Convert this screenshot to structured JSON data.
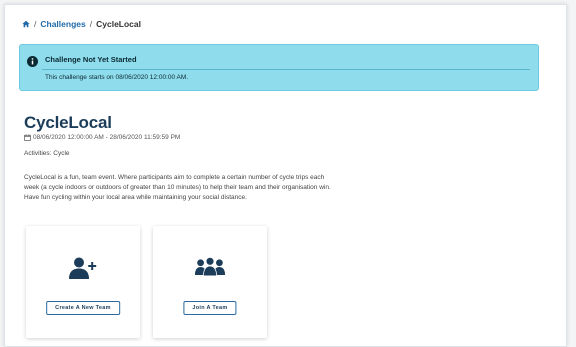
{
  "breadcrumb": {
    "home_icon": "home-icon",
    "sep1": "/",
    "challenges": "Challenges",
    "sep2": "/",
    "current": "CycleLocal"
  },
  "alert": {
    "icon": "info-icon",
    "title": "Challenge Not Yet Started",
    "text": "This challenge starts on 08/06/2020 12:00:00 AM.",
    "color": "#8fdcec"
  },
  "challenge": {
    "title": "CycleLocal",
    "dates": "08/06/2020 12:00:00 AM - 28/06/2020 11:59:59 PM",
    "activities": "Activities: Cycle",
    "description": [
      "CycleLocal is a fun, team event. Where participants aim to complete a certain number of cycle trips each",
      "week (a cycle indoors or outdoors of greater than 10 minutes) to help their team and their organisation win.",
      "Have fun cycling within your local area while maintaining your social distance."
    ]
  },
  "cards": [
    {
      "icon": "add-user-icon",
      "button_label": "Create A New Team"
    },
    {
      "icon": "users-group-icon",
      "button_label": "Join A Team"
    }
  ],
  "colors": {
    "title": "#1c3d5a",
    "link": "#1f6aa8",
    "accent": "#2a6aa0"
  }
}
